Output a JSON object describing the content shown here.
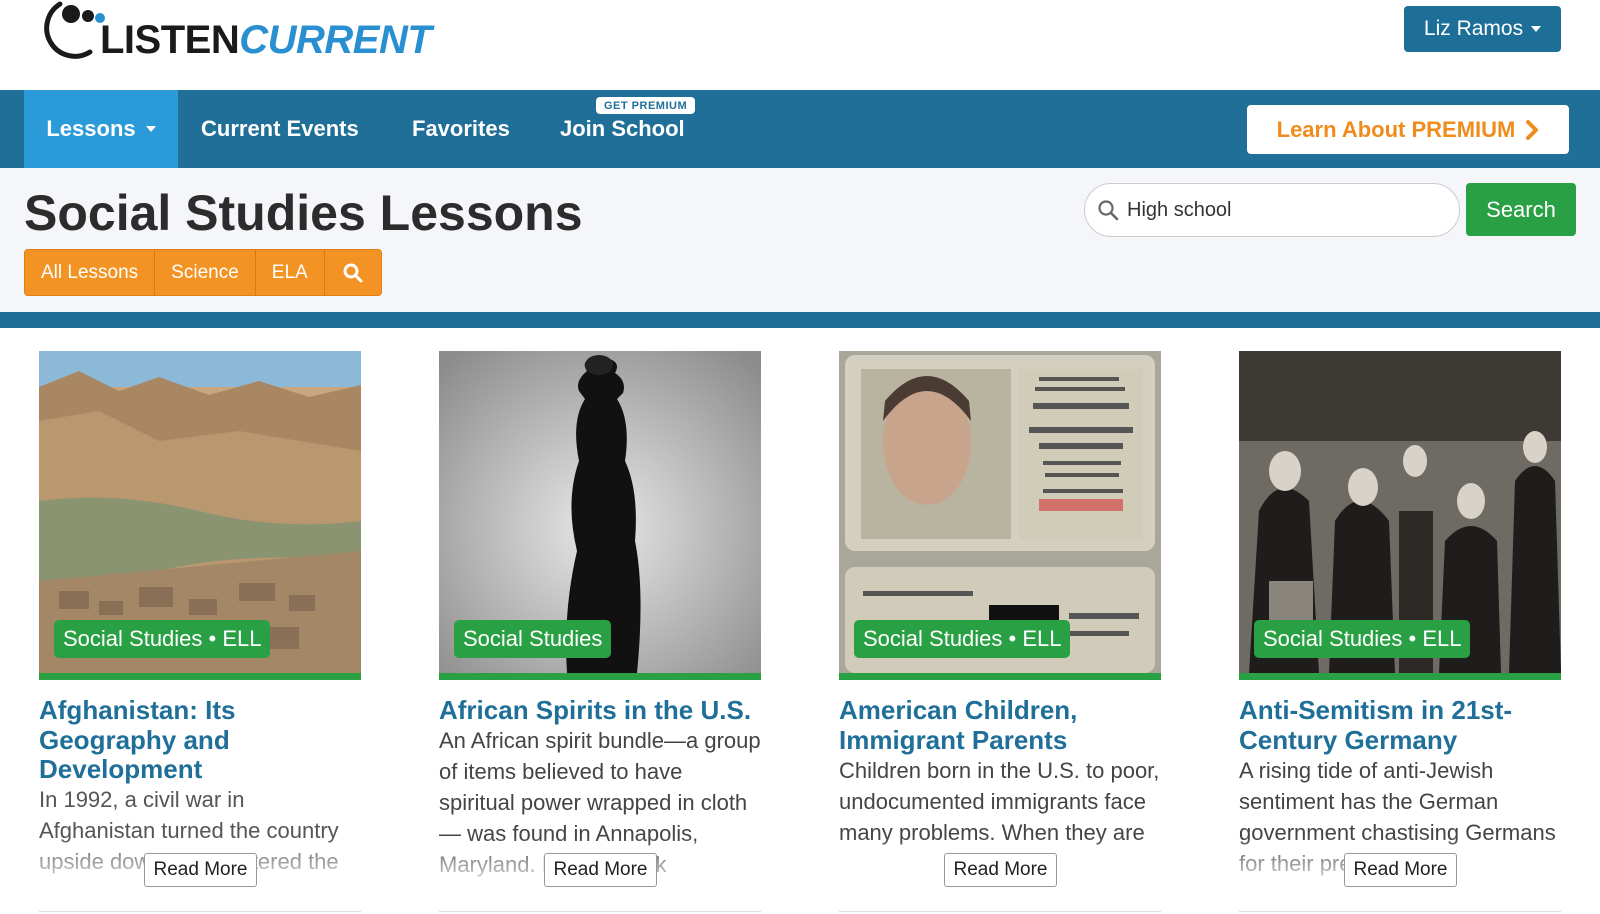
{
  "header": {
    "logo_text_listen": "LISTEN",
    "logo_text_current": "CURRENT",
    "user_name": "Liz Ramos"
  },
  "nav": {
    "items": [
      {
        "label": "Lessons",
        "active": true
      },
      {
        "label": "Current Events"
      },
      {
        "label": "Favorites"
      },
      {
        "label": "Join School",
        "badge": "GET PREMIUM"
      }
    ],
    "learn_premium": "Learn About PREMIUM"
  },
  "page": {
    "title": "Social Studies Lessons",
    "filters": [
      "All Lessons",
      "Science",
      "ELA"
    ],
    "search_value": "High school",
    "search_button": "Search"
  },
  "colors": {
    "brand_blue": "#1f6f99",
    "active_tab": "#2a9ad9",
    "orange": "#f39323",
    "green": "#2aa044"
  },
  "cards": [
    {
      "tag": "Social Studies • ELL",
      "title": "Afghanistan: Its Geography and Development",
      "description": "In 1992, a civil war in Afghanistan turned the country upside down and scattered the",
      "read_more": "Read More"
    },
    {
      "tag": "Social Studies",
      "title": "African Spirits in the U.S.",
      "description": "An African spirit bundle—a group of items believed to have spiritual power wrapped in cloth— was found in Annapolis, Maryland. It dates back",
      "read_more": "Read More"
    },
    {
      "tag": "Social Studies • ELL",
      "title": "American Children, Immigrant Parents",
      "description": "Children born in the U.S. to poor, undocumented immigrants face many problems. When they are",
      "read_more": "Read More"
    },
    {
      "tag": "Social Studies • ELL",
      "title": "Anti-Semitism in 21st-Century Germany",
      "description": "A rising tide of anti-Jewish sentiment has the German government chastising Germans for their prejudice.",
      "read_more": "Read More"
    }
  ]
}
